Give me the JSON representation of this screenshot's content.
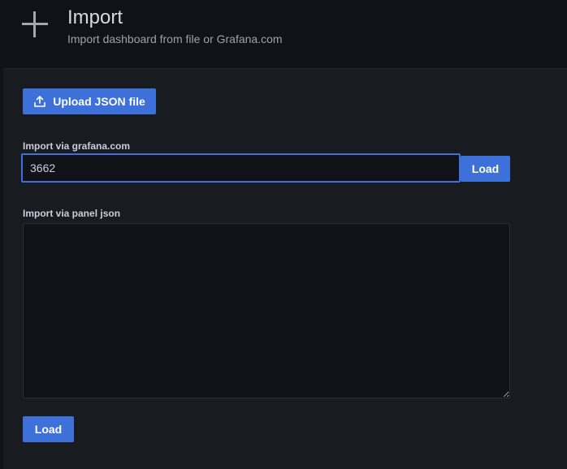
{
  "header": {
    "title": "Import",
    "subtitle": "Import dashboard from file or Grafana.com",
    "icon": "plus-icon"
  },
  "upload": {
    "label": "Upload JSON file",
    "icon": "upload-icon"
  },
  "grafana_com": {
    "label": "Import via grafana.com",
    "value": "3662",
    "load_label": "Load"
  },
  "panel_json": {
    "label": "Import via panel json",
    "value": "",
    "load_label": "Load"
  },
  "colors": {
    "accent": "#3d71d9",
    "background": "#111217",
    "panel": "#181b1f"
  }
}
